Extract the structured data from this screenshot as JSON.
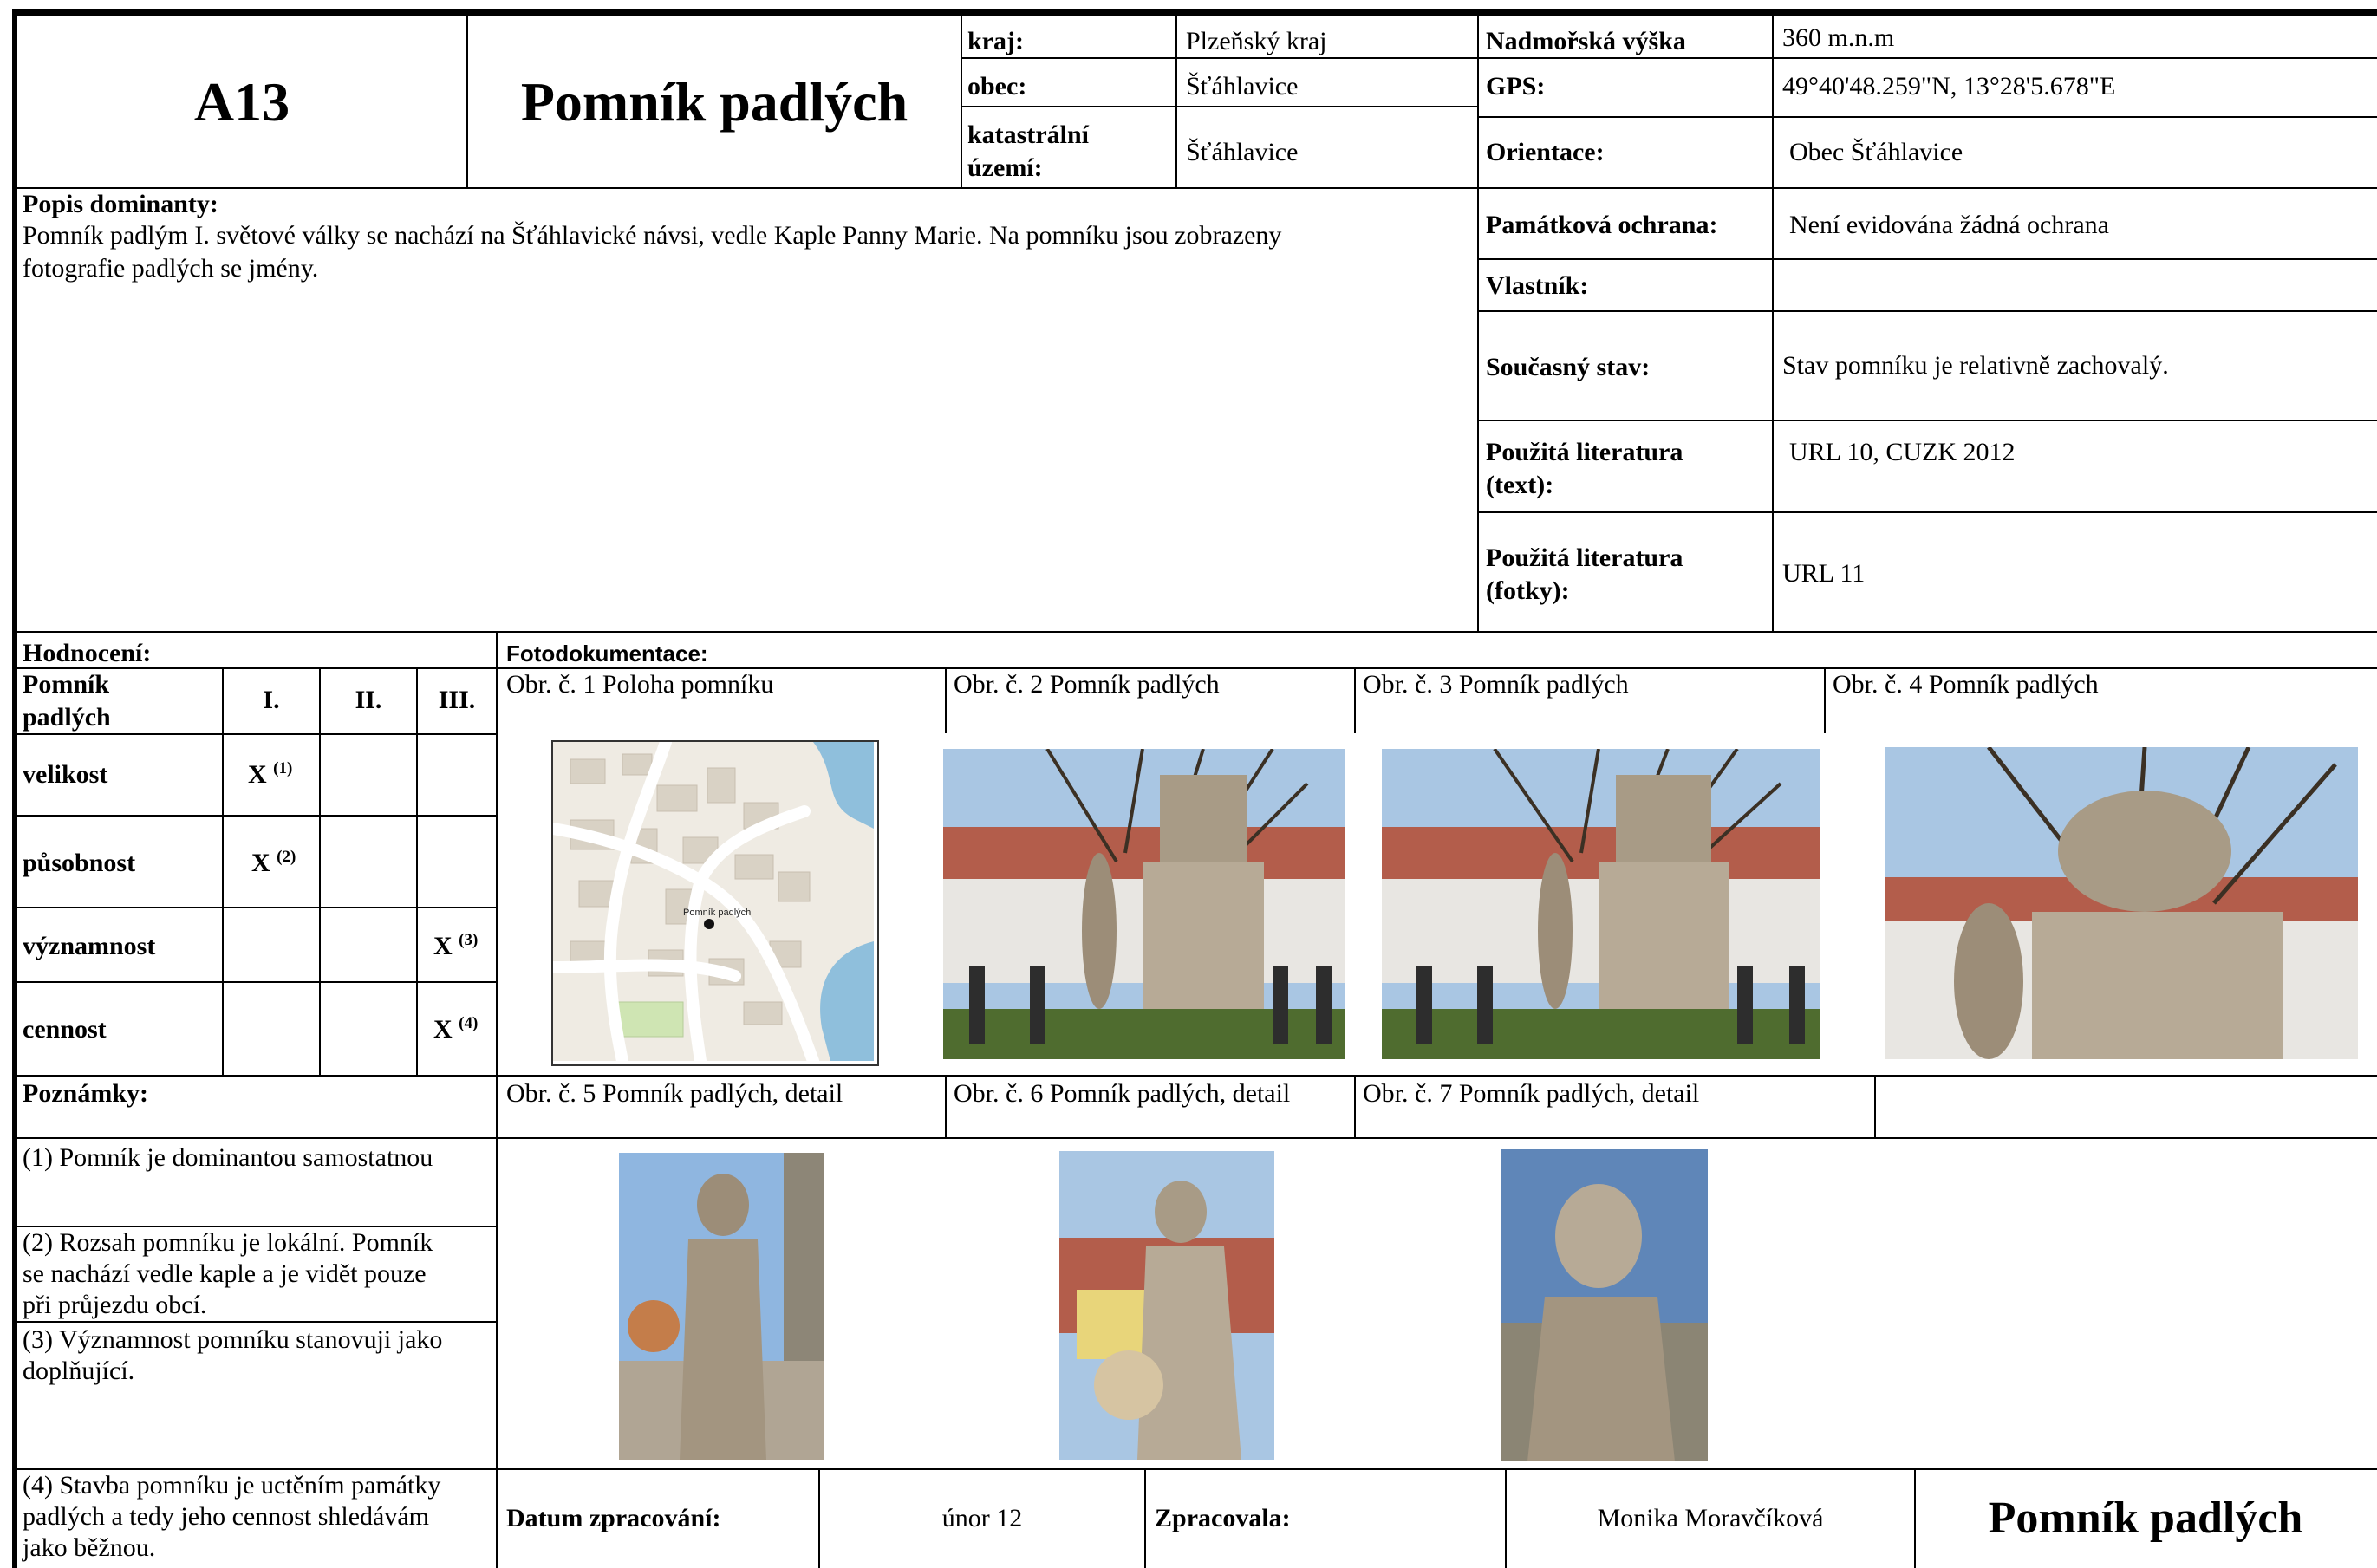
{
  "header": {
    "code": "A13",
    "title": "Pomník padlých",
    "kraj_label": "kraj:",
    "kraj_value": "Plzeňský kraj",
    "obec_label": "obec:",
    "obec_value": "Šťáhlavice",
    "katastr_label_1": "katastrální",
    "katastr_label_2": "území:",
    "katastr_value": "Šťáhlavice",
    "vyska_label": "Nadmořská výška",
    "vyska_value": "360 m.n.m",
    "gps_label": "GPS:",
    "gps_value": "49°40'48.259\"N, 13°28'5.678\"E"
  },
  "info": {
    "orientace_label": "Orientace:",
    "orientace_value": "Obec Šťáhlavice",
    "ochrana_label": "Památková ochrana:",
    "ochrana_value": "Není evidována žádná ochrana",
    "vlastnik_label": "Vlastník:",
    "vlastnik_value": "",
    "stav_label": "Současný stav:",
    "stav_value": "Stav pomníku je relativně zachovalý.",
    "lit_text_label_1": "Použitá literatura",
    "lit_text_label_2": "(text):",
    "lit_text_value": "URL 10, CUZK 2012",
    "lit_foto_label_1": "Použitá literatura",
    "lit_foto_label_2": "(fotky):",
    "lit_foto_value": "URL 11"
  },
  "popis": {
    "label": "Popis dominanty:",
    "line1": "Pomník padlým I. světové války se nachází na Šťáhlavické návsi, vedle Kaple Panny Marie. Na pomníku jsou zobrazeny",
    "line2": "fotografie padlých se jmény."
  },
  "hodnoceni": {
    "label": "Hodnocení:",
    "corner_1": "Pomník",
    "corner_2": "padlých",
    "columns": [
      "I.",
      "II.",
      "III."
    ],
    "rows": [
      {
        "name": "velikost",
        "mark": "X",
        "note": "(1)",
        "col": 1
      },
      {
        "name": "působnost",
        "mark": "X",
        "note": "(2)",
        "col": 1
      },
      {
        "name": "významnost",
        "mark": "X",
        "note": "(3)",
        "col": 3
      },
      {
        "name": "cennost",
        "mark": "X",
        "note": "(4)",
        "col": 3
      }
    ]
  },
  "poznamky": {
    "label": "Poznámky:",
    "note1": "(1) Pomník je dominantou samostatnou",
    "note2": [
      "(2) Rozsah pomníku je lokální. Pomník",
      "se nachází vedle kaple a je vidět pouze",
      "při průjezdu obcí."
    ],
    "note3": [
      "(3) Významnost pomníku stanovuji jako",
      "doplňující."
    ],
    "note4": [
      "(4) Stavba pomníku je uctěním památky",
      "padlých a tedy jeho cennost shledávám",
      "jako běžnou."
    ]
  },
  "foto": {
    "label": "Fotodokumentace:",
    "captions_top": [
      "Obr. č. 1 Poloha pomníku",
      "Obr. č. 2 Pomník padlých",
      "Obr. č. 3 Pomník padlých",
      "Obr. č. 4 Pomník padlých"
    ],
    "captions_bottom": [
      "Obr. č. 5 Pomník padlých, detail",
      "Obr. č. 6 Pomník padlých, detail",
      "Obr. č. 7 Pomník padlých, detail"
    ],
    "map_label": "Pomník padlých"
  },
  "footer": {
    "datum_label": "Datum zpracování:",
    "datum_value": "únor 12",
    "zpracovala_label": "Zpracovala:",
    "zpracovala_value": "Monika Moravčíková",
    "title": "Pomník padlých"
  },
  "colors": {
    "water": "#8fbfdc",
    "map_bg": "#efebe3",
    "building": "#d9d2c5",
    "sky": "#a9c6e3",
    "stone": "#b7aa96"
  }
}
